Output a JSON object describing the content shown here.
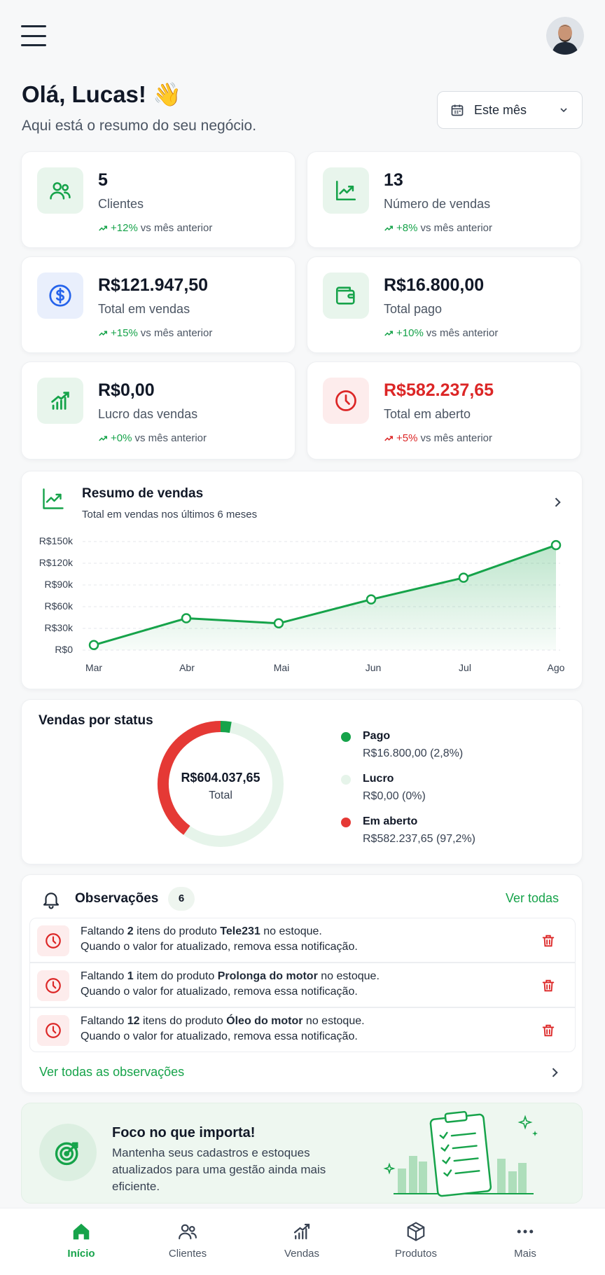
{
  "header": {
    "greeting": "Olá, Lucas! 👋",
    "subtitle": "Aqui está o resumo do seu negócio.",
    "period_label": "Este mês"
  },
  "stats": [
    {
      "value": "5",
      "label": "Clientes",
      "pct": "+12%",
      "suffix": "vs mês anterior"
    },
    {
      "value": "13",
      "label": "Número de vendas",
      "pct": "+8%",
      "suffix": "vs mês anterior"
    },
    {
      "value": "R$121.947,50",
      "label": "Total em vendas",
      "pct": "+15%",
      "suffix": "vs mês anterior"
    },
    {
      "value": "R$16.800,00",
      "label": "Total pago",
      "pct": "+10%",
      "suffix": "vs mês anterior"
    },
    {
      "value": "R$0,00",
      "label": "Lucro das vendas",
      "pct": "+0%",
      "suffix": "vs mês anterior"
    },
    {
      "value": "R$582.237,65",
      "label": "Total em aberto",
      "pct": "+5%",
      "suffix": "vs mês anterior"
    }
  ],
  "sales_chart": {
    "title": "Resumo de vendas",
    "subtitle": "Total em vendas nos últimos 6 meses",
    "y_ticks": [
      "R$150k",
      "R$120k",
      "R$90k",
      "R$60k",
      "R$30k",
      "R$0"
    ],
    "x_ticks": [
      "Mar",
      "Abr",
      "Mai",
      "Jun",
      "Jul",
      "Ago"
    ]
  },
  "chart_data": {
    "type": "area",
    "x": [
      "Mar",
      "Abr",
      "Mai",
      "Jun",
      "Jul",
      "Ago"
    ],
    "series": [
      {
        "values": [
          7000,
          44000,
          37000,
          70000,
          100000,
          145000
        ]
      }
    ],
    "ylim": [
      0,
      150000
    ],
    "grid": true,
    "color": "#16a34a"
  },
  "status": {
    "title": "Vendas por status",
    "center_value": "R$604.037,65",
    "center_label": "Total",
    "items": [
      {
        "name": "Pago",
        "detail": "R$16.800,00 (2,8%)",
        "fraction": 0.028,
        "color": "#16a34a"
      },
      {
        "name": "Lucro",
        "detail": "R$0,00 (0%)",
        "fraction": 0.0,
        "color": "#e6f4ea"
      },
      {
        "name": "Em aberto",
        "detail": "R$582.237,65 (97,2%)",
        "fraction": 0.4,
        "color": "#e53935"
      }
    ]
  },
  "observations": {
    "title": "Observações",
    "count": "6",
    "see_all": "Ver todas",
    "see_all_bottom": "Ver todas as observações",
    "items": [
      {
        "pre": "Faltando ",
        "qty": "2",
        "mid": " itens do produto ",
        "product": "Tele231",
        "post": " no estoque.",
        "line2": "Quando o valor for atualizado, remova essa notificação."
      },
      {
        "pre": "Faltando ",
        "qty": "1",
        "mid": " item do produto ",
        "product": "Prolonga do motor",
        "post": " no estoque.",
        "line2": "Quando o valor for atualizado, remova essa notificação."
      },
      {
        "pre": "Faltando ",
        "qty": "12",
        "mid": " itens do produto ",
        "product": "Óleo do motor",
        "post": " no estoque.",
        "line2": "Quando o valor for atualizado, remova essa notificação."
      }
    ]
  },
  "focus": {
    "title": "Foco no que importa!",
    "text": "Mantenha seus cadastros e estoques atualizados para uma gestão ainda mais eficiente."
  },
  "nav": [
    {
      "label": "Início",
      "icon": "home-icon",
      "active": true
    },
    {
      "label": "Clientes",
      "icon": "users-icon",
      "active": false
    },
    {
      "label": "Vendas",
      "icon": "bar-chart-icon",
      "active": false
    },
    {
      "label": "Produtos",
      "icon": "box-icon",
      "active": false
    },
    {
      "label": "Mais",
      "icon": "more-icon",
      "active": false
    }
  ],
  "colors": {
    "accent": "#16a34a",
    "danger": "#dc2626",
    "blue": "#2563eb"
  }
}
